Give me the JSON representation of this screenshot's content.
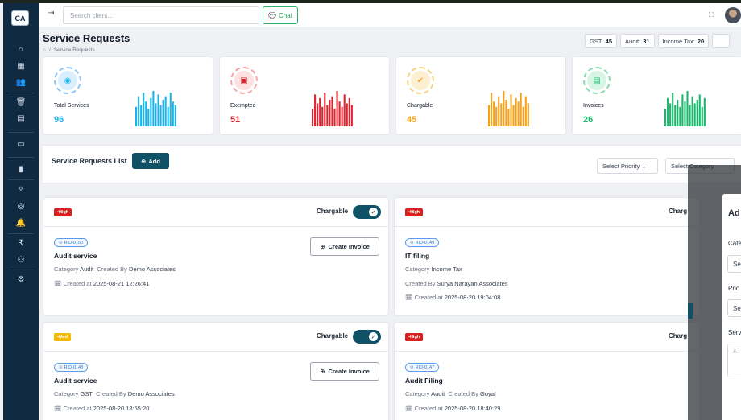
{
  "brand": {
    "logo_text": "CA"
  },
  "sidebar": {
    "items": [
      {
        "icon": "home-icon",
        "glyph": "⌂"
      },
      {
        "icon": "grid-icon",
        "glyph": "▦"
      },
      {
        "icon": "users-icon",
        "glyph": "👥"
      },
      {
        "icon": "trash-icon",
        "glyph": "🗑"
      },
      {
        "icon": "document-icon",
        "glyph": "▤"
      },
      {
        "icon": "calendar-icon",
        "glyph": "▭"
      },
      {
        "icon": "file-icon",
        "glyph": "▮"
      },
      {
        "icon": "star-icon",
        "glyph": "✧"
      },
      {
        "icon": "whatsapp-icon",
        "glyph": "◎"
      },
      {
        "icon": "bell-icon",
        "glyph": "🔔"
      },
      {
        "icon": "rupee-icon",
        "glyph": "₹"
      },
      {
        "icon": "user-settings-icon",
        "glyph": "⚇"
      },
      {
        "icon": "gear-icon",
        "glyph": "⚙"
      }
    ]
  },
  "topbar": {
    "search_placeholder": "Search client...",
    "chat_label": "Chat"
  },
  "page": {
    "title": "Service Requests",
    "breadcrumb_current": "Service Requests"
  },
  "counts": [
    {
      "label": "GST:",
      "value": "45"
    },
    {
      "label": "Audit:",
      "value": "31"
    },
    {
      "label": "Income Tax:",
      "value": "20"
    }
  ],
  "stats": [
    {
      "label": "Total Services",
      "value": "96",
      "color": "#19b5ea",
      "soft": "#dbeefe",
      "ring": "#8cc4f8",
      "glyph": "◉",
      "bars": [
        0.55,
        0.85,
        0.6,
        0.95,
        0.7,
        0.5,
        0.8,
        1.0,
        0.65,
        0.9,
        0.6,
        0.75,
        0.85,
        0.55,
        0.95,
        0.7,
        0.6
      ]
    },
    {
      "label": "Exempted",
      "value": "51",
      "color": "#e0242f",
      "soft": "#fde0e0",
      "ring": "#f7a3a8",
      "glyph": "▣",
      "bars": [
        0.5,
        0.9,
        0.65,
        0.8,
        0.55,
        0.95,
        0.6,
        0.75,
        0.85,
        0.5,
        1.0,
        0.7,
        0.55,
        0.9,
        0.65,
        0.8,
        0.6
      ]
    },
    {
      "label": "Chargable",
      "value": "45",
      "color": "#f5a21b",
      "soft": "#fdf0d2",
      "ring": "#f8d27f",
      "glyph": "✔",
      "bars": [
        0.6,
        0.95,
        0.7,
        0.55,
        0.85,
        0.65,
        1.0,
        0.75,
        0.5,
        0.9,
        0.6,
        0.8,
        0.7,
        0.95,
        0.55,
        0.85,
        0.65
      ]
    },
    {
      "label": "Invoices",
      "value": "26",
      "color": "#19b86a",
      "soft": "#d6f5e4",
      "ring": "#86dcae",
      "glyph": "▤",
      "bars": [
        0.5,
        0.8,
        0.65,
        0.95,
        0.6,
        0.75,
        0.55,
        0.9,
        0.7,
        1.0,
        0.6,
        0.85,
        0.65,
        0.75,
        0.9,
        0.55,
        0.8
      ]
    }
  ],
  "list": {
    "title": "Service Requests List",
    "add_label": "Add",
    "priority_select": "Select Priority",
    "category_select": "Select Category"
  },
  "cards": [
    {
      "priority": "High",
      "charge_label": "Chargable",
      "rid": "RID-0150",
      "title": "Audit service",
      "category_label": "Category",
      "category": "Audit",
      "created_by_label": "Created By",
      "created_by": "Demo Associates",
      "created_at_label": "Created at",
      "created_at": "2025-08-21 12:26:41",
      "invoice_label": "Create Invoice"
    },
    {
      "priority": "High",
      "charge_label": "Charg",
      "rid": "RID-0149",
      "title": "IT filing",
      "category_label": "Category",
      "category": "Income Tax",
      "created_by_label": "Created By",
      "created_by": "Surya Narayan Associates",
      "created_at_label": "Created at",
      "created_at": "2025-08-20 19:04:08"
    },
    {
      "priority": "Med",
      "charge_label": "Chargable",
      "rid": "RID-0148",
      "title": "Audit service",
      "category_label": "Category",
      "category": "GST",
      "created_by_label": "Created By",
      "created_by": "Demo Associates",
      "created_at_label": "Created at",
      "created_at": "2025-08-20 18:55:20",
      "invoice_label": "Create Invoice"
    },
    {
      "priority": "High",
      "charge_label": "Charg",
      "rid": "RID-0147",
      "title": "Audit Filing",
      "category_label": "Category",
      "category": "Audit",
      "created_by_label": "Created By",
      "created_by": "Goyal",
      "created_at_label": "Created at",
      "created_at": "2025-08-20 18:40:29"
    }
  ],
  "modal": {
    "title": "Ad",
    "category_label": "Cate",
    "category_value": "Se",
    "priority_label": "Prio",
    "priority_value": "Se",
    "service_label": "Serv",
    "service_placeholder": "A"
  }
}
